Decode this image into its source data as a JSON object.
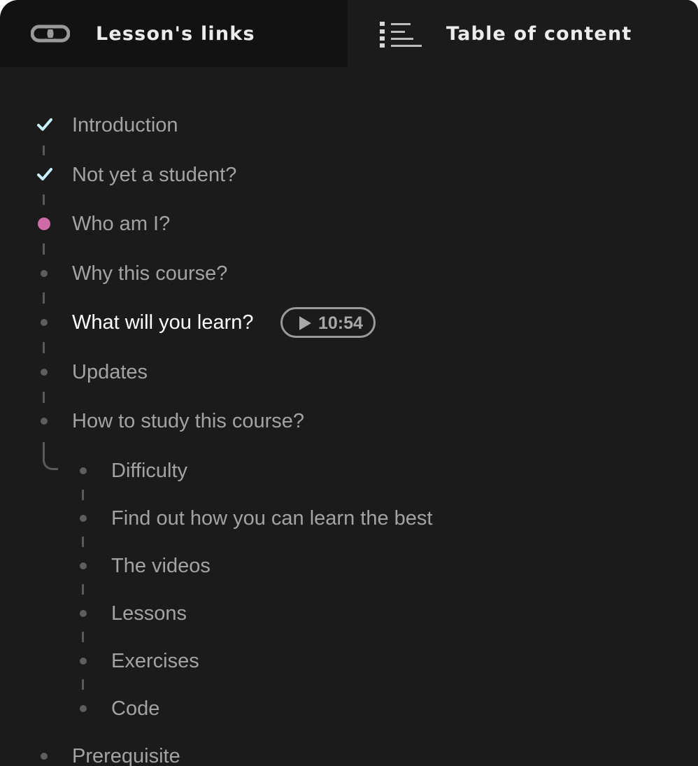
{
  "tabs": {
    "links_label": "Lesson's links",
    "toc_label": "Table of content"
  },
  "colors": {
    "background": "#1b1b1b",
    "inactive_tab": "#121212",
    "check": "#c9f3ff",
    "current_dot": "#cf6aa8",
    "dot": "#5e5e5e",
    "text": "#a3a3a3",
    "text_current": "#ffffff"
  },
  "toc": {
    "items": [
      {
        "label": "Introduction",
        "status": "done"
      },
      {
        "label": "Not yet a student?",
        "status": "done"
      },
      {
        "label": "Who am I?",
        "status": "current"
      },
      {
        "label": "Why this course?",
        "status": "todo"
      },
      {
        "label": "What will you learn?",
        "status": "todo",
        "duration": "10:54"
      },
      {
        "label": "Updates",
        "status": "todo"
      },
      {
        "label": "How to study this course?",
        "status": "todo"
      }
    ],
    "subitems": [
      {
        "label": "Difficulty"
      },
      {
        "label": "Find out how you can learn the best"
      },
      {
        "label": "The videos"
      },
      {
        "label": "Lessons"
      },
      {
        "label": "Exercises"
      },
      {
        "label": "Code"
      }
    ],
    "after": [
      {
        "label": "Prerequisite"
      }
    ]
  }
}
